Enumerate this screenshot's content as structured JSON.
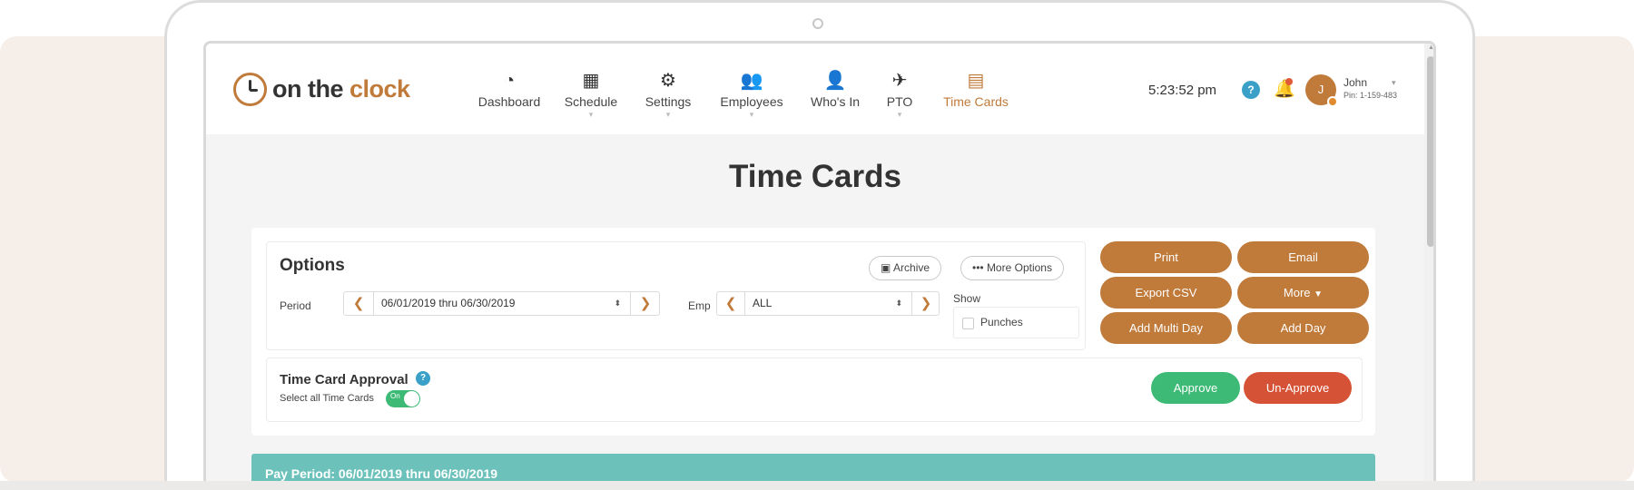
{
  "app": {
    "logo_prefix": "on the ",
    "logo_accent": "clock"
  },
  "nav": {
    "items": [
      {
        "label": "Dashboard",
        "icon": "speedometer-icon",
        "has_caret": false,
        "active": false
      },
      {
        "label": "Schedule",
        "icon": "calendar-icon",
        "has_caret": true,
        "active": false
      },
      {
        "label": "Settings",
        "icon": "gears-icon",
        "has_caret": true,
        "active": false
      },
      {
        "label": "Employees",
        "icon": "users-icon",
        "has_caret": true,
        "active": false
      },
      {
        "label": "Who's In",
        "icon": "user-clock-icon",
        "has_caret": false,
        "active": false
      },
      {
        "label": "PTO",
        "icon": "airplane-icon",
        "has_caret": true,
        "active": false
      },
      {
        "label": "Time Cards",
        "icon": "timecard-grid-icon",
        "has_caret": false,
        "active": true
      }
    ]
  },
  "header": {
    "time": "5:23:52 pm",
    "help_icon": "?",
    "user": {
      "avatar_initial": "J",
      "name": "John",
      "pin": "Pin: 1-159-483"
    }
  },
  "page": {
    "title": "Time Cards"
  },
  "options": {
    "title": "Options",
    "archive_label": "Archive",
    "more_options_label": "••• More Options",
    "period_label": "Period",
    "period_value": "06/01/2019 thru 06/30/2019",
    "emp_label": "Emp",
    "emp_value": "ALL",
    "show_label": "Show",
    "punches_label": "Punches",
    "punches_checked": false
  },
  "actions": {
    "print": "Print",
    "email": "Email",
    "export_csv": "Export CSV",
    "more": "More",
    "add_multi_day": "Add Multi Day",
    "add_day": "Add Day"
  },
  "approval": {
    "title": "Time Card Approval",
    "help_icon": "?",
    "select_all_label": "Select all Time Cards",
    "toggle_label": "On",
    "approve_label": "Approve",
    "unapprove_label": "Un-Approve"
  },
  "pay_period": {
    "text": "Pay Period: 06/01/2019 thru 06/30/2019"
  },
  "colors": {
    "brand": "#c07a3a",
    "approve": "#3dba75",
    "unapprove": "#d65236",
    "pay_period_bar": "#6cc2ba",
    "help": "#3aa0c8"
  }
}
